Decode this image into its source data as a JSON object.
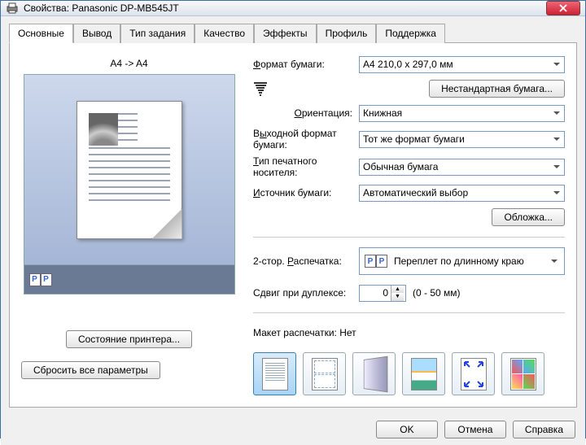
{
  "window": {
    "title": "Свойства: Panasonic DP-MB545JT"
  },
  "tabs": [
    "Основные",
    "Вывод",
    "Тип задания",
    "Качество",
    "Эффекты",
    "Профиль",
    "Поддержка"
  ],
  "preview": {
    "title": "A4 -> A4"
  },
  "buttons": {
    "printer_status": "Состояние принтера...",
    "reset": "Сбросить все параметры",
    "custom_paper": "Нестандартная бумага...",
    "cover": "Обложка...",
    "ok": "OK",
    "cancel": "Отмена",
    "help": "Справка"
  },
  "labels": {
    "paper_size": "Формат бумаги:",
    "orientation": "Ориентация:",
    "output_size": "Выходной формат бумаги:",
    "media_type": "Тип печатного носителя:",
    "paper_source": "Источник бумаги:",
    "duplex": "2-стор. Распечатка:",
    "duplex_shift": "Сдвиг при дуплексе:",
    "layout": "Макет распечатки:",
    "layout_value": "Нет",
    "shift_range": "(0 - 50 мм)"
  },
  "values": {
    "paper_size": "A4  210,0 x 297,0 мм",
    "orientation": "Книжная",
    "output_size": "Тот же формат бумаги",
    "media_type": "Обычная бумага",
    "paper_source": "Автоматический выбор",
    "duplex": "Переплет по длинному краю",
    "shift": "0"
  }
}
